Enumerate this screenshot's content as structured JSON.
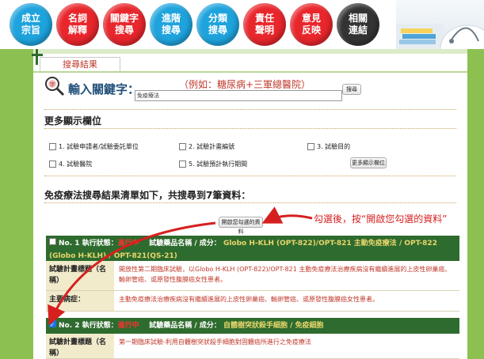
{
  "nav": {
    "items": [
      {
        "label": "成立\n宗旨",
        "color": "#1ea3dd"
      },
      {
        "label": "名詞\n解釋",
        "color": "#e8262c"
      },
      {
        "label": "關鍵字\n搜尋",
        "color": "#e8262c"
      },
      {
        "label": "進階\n搜尋",
        "color": "#1ea3dd"
      },
      {
        "label": "分類\n搜尋",
        "color": "#1ea3dd"
      },
      {
        "label": "責任\n聲明",
        "color": "#e8262c"
      },
      {
        "label": "意見\n反映",
        "color": "#e8262c"
      },
      {
        "label": "相關\n連結",
        "color": "#333333"
      }
    ]
  },
  "tab": {
    "label": "搜尋結果"
  },
  "search": {
    "title": "輸入關鍵字：",
    "example": "（例如：糖尿病+三軍總醫院）",
    "value": "免疫療法",
    "button": "搜尋"
  },
  "more_fields": {
    "title": "更多顯示欄位",
    "options": [
      {
        "label": "1. 試驗申請者/試驗委託單位"
      },
      {
        "label": "2. 試驗計畫編號"
      },
      {
        "label": "3. 試驗目的"
      },
      {
        "label": "4. 試驗醫院"
      },
      {
        "label": "5. 試驗預計執行期間"
      }
    ],
    "button": "更多顯示欄位"
  },
  "results_summary": "免疫療法搜尋結果清單如下，共搜尋到7筆資料：",
  "open_selected_button": "開啟您勾選的資料",
  "annotation": "勾選後，按“開啟您勾選的資料”",
  "results": [
    {
      "head_no": "No. 1 執行狀態：",
      "status": "進行中",
      "drug_label": "試驗藥品名稱 / 成分：",
      "drug": "Globo H-KLH (OPT-822)/OPT-821 主動免疫療法 / OPT-822 (Globo H-KLH) / OPT-821(QS-21)",
      "rows": [
        {
          "label": "試驗計畫標題（名稱）",
          "value": "開放性第二期臨床試驗，以Globo H-KLH (OPT-822)/OPT-821 主動免疫療法治療疾病沒有繼續進展的上皮性卵巢癌、輸卵管癌、或原發性腹膜癌女性患者。"
        },
        {
          "label": "主要病症：",
          "value": "主動免疫療法治療疾病沒有繼續進展的上皮性卵巢癌、輸卵管癌、或原發性腹膜癌女性患者。"
        }
      ]
    },
    {
      "head_no": "No. 2 執行狀態：",
      "status": "進行中",
      "drug_label": "試驗藥品名稱 / 成分：",
      "drug": "自體樹突狀殺手細胞 / 免疫細胞",
      "rows": [
        {
          "label": "試驗計畫標題（名稱）",
          "value": "第一期臨床試驗-利用自體樹突狀殺手細胞對固體癌所進行之免疫療法"
        }
      ]
    }
  ]
}
